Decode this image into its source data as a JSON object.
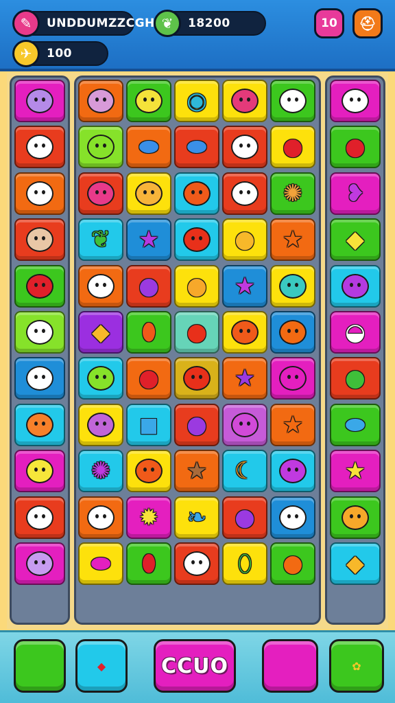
{
  "hud": {
    "player_name": "UNDDUMZZCGH",
    "score": "18200",
    "coins": "100",
    "level": "10",
    "icons": {
      "player": "pencil-icon",
      "score": "leaf-icon",
      "coins": "bird-coin-icon",
      "level": "level-badge",
      "shop": "chef-hat-icon"
    }
  },
  "colors": {
    "hud_bg": "#1d6fc4",
    "board_bg": "#f5d98a",
    "bottom_bg": "#4fbcd8",
    "red": "#e83c1e",
    "orange": "#f26a12",
    "yellow": "#fde10c",
    "green": "#3cc71e",
    "lime": "#86e22a",
    "cyan": "#22c9ea",
    "blue": "#1f8ed8",
    "purple": "#9b2fe0",
    "magenta": "#e41fbf",
    "teal": "#66d4b8",
    "mustard": "#d9b21a",
    "violet": "#c65bd8"
  },
  "grid": {
    "left_column": [
      {
        "bg": "magenta",
        "icon": "ghost-face-icon",
        "fg": "#b58ae8"
      },
      {
        "bg": "red",
        "icon": "bear-face-icon",
        "fg": "#ffffff"
      },
      {
        "bg": "orange",
        "icon": "bear-face-icon",
        "fg": "#ffffff"
      },
      {
        "bg": "red",
        "icon": "blob-face-icon",
        "fg": "#e9c7a6"
      },
      {
        "bg": "green",
        "icon": "strawberry-face-icon",
        "fg": "#e0202a"
      },
      {
        "bg": "lime",
        "icon": "ghost-face-icon",
        "fg": "#ffffff"
      },
      {
        "bg": "blue",
        "icon": "ghost-face-icon",
        "fg": "#ffffff"
      },
      {
        "bg": "cyan",
        "icon": "orange-face-icon",
        "fg": "#f7802a"
      },
      {
        "bg": "magenta",
        "icon": "lemon-face-icon",
        "fg": "#f6e63a"
      },
      {
        "bg": "red",
        "icon": "egg-face-icon",
        "fg": "#ffffff"
      },
      {
        "bg": "magenta",
        "icon": "ghost-face-icon",
        "fg": "#c79cf0"
      }
    ],
    "main_rows": [
      [
        {
          "bg": "orange",
          "icon": "ghost-face-icon",
          "fg": "#d89ad8"
        },
        {
          "bg": "green",
          "icon": "sun-face-icon",
          "fg": "#f4e23a"
        },
        {
          "bg": "yellow",
          "icon": "bird-icon",
          "fg": "#2fb8d8"
        },
        {
          "bg": "yellow",
          "icon": "urchin-face-icon",
          "fg": "#e43a7a"
        },
        {
          "bg": "green",
          "icon": "ghost-face-icon",
          "fg": "#ffffff"
        }
      ],
      [
        {
          "bg": "lime",
          "icon": "ghost-face-icon",
          "fg": "#86e22a"
        },
        {
          "bg": "orange",
          "icon": "candy-icon",
          "fg": "#3a8fe8"
        },
        {
          "bg": "red",
          "icon": "candy-icon",
          "fg": "#3a8fe8"
        },
        {
          "bg": "red",
          "icon": "egg-face-icon",
          "fg": "#ffffff"
        },
        {
          "bg": "yellow",
          "icon": "tomato-icon",
          "fg": "#e0202a"
        }
      ],
      [
        {
          "bg": "red",
          "icon": "berry-face-icon",
          "fg": "#e83a8a"
        },
        {
          "bg": "yellow",
          "icon": "cat-face-icon",
          "fg": "#f7b43a"
        },
        {
          "bg": "cyan",
          "icon": "orange-face-icon",
          "fg": "#f05a1a"
        },
        {
          "bg": "red",
          "icon": "bear-face-icon",
          "fg": "#ffffff"
        },
        {
          "bg": "green",
          "icon": "cookie-icon",
          "fg": "#f2a23a"
        }
      ],
      [
        {
          "bg": "cyan",
          "icon": "leaf-icon",
          "fg": "#3fbf3a"
        },
        {
          "bg": "blue",
          "icon": "star-icon",
          "fg": "#b43ae0"
        },
        {
          "bg": "cyan",
          "icon": "tomato-face-icon",
          "fg": "#e8301a"
        },
        {
          "bg": "yellow",
          "icon": "orange-fruit-icon",
          "fg": "#f7b82a"
        },
        {
          "bg": "orange",
          "icon": "star-icon",
          "fg": "#f26a12"
        }
      ],
      [
        {
          "bg": "orange",
          "icon": "ghost-face-icon",
          "fg": "#ffffff"
        },
        {
          "bg": "red",
          "icon": "plum-icon",
          "fg": "#9b3ae0"
        },
        {
          "bg": "yellow",
          "icon": "orange-fruit-icon",
          "fg": "#f7a82a"
        },
        {
          "bg": "blue",
          "icon": "star-icon",
          "fg": "#c03ae0"
        },
        {
          "bg": "yellow",
          "icon": "fish-face-icon",
          "fg": "#3ac9c0"
        }
      ],
      [
        {
          "bg": "purple",
          "icon": "gem-icon",
          "fg": "#f7b82a"
        },
        {
          "bg": "green",
          "icon": "carrot-icon",
          "fg": "#f05a1a"
        },
        {
          "bg": "teal",
          "icon": "tomato-icon",
          "fg": "#e8301a"
        },
        {
          "bg": "yellow",
          "icon": "cat-face-icon",
          "fg": "#f05a1a"
        },
        {
          "bg": "blue",
          "icon": "blob-face-icon",
          "fg": "#f26a12"
        }
      ],
      [
        {
          "bg": "cyan",
          "icon": "ghost-face-icon",
          "fg": "#86e22a"
        },
        {
          "bg": "orange",
          "icon": "apple-icon",
          "fg": "#e0202a"
        },
        {
          "bg": "mustard",
          "icon": "tomato-face-icon",
          "fg": "#e8301a"
        },
        {
          "bg": "orange",
          "icon": "star-icon",
          "fg": "#9b3ae0"
        },
        {
          "bg": "magenta",
          "icon": "ghost-face-icon",
          "fg": "#e41fbf"
        }
      ],
      [
        {
          "bg": "yellow",
          "icon": "ghost-face-icon",
          "fg": "#c065d8"
        },
        {
          "bg": "cyan",
          "icon": "box-icon",
          "fg": "#3aa8e8"
        },
        {
          "bg": "red",
          "icon": "plum-icon",
          "fg": "#9b3ae0"
        },
        {
          "bg": "violet",
          "icon": "ghost-face-icon",
          "fg": "#d14ad8"
        },
        {
          "bg": "orange",
          "icon": "star-icon",
          "fg": "#f26a12"
        }
      ],
      [
        {
          "bg": "cyan",
          "icon": "cookie-icon",
          "fg": "#c03ae0"
        },
        {
          "bg": "yellow",
          "icon": "cat-face-icon",
          "fg": "#f05a1a"
        },
        {
          "bg": "orange",
          "icon": "star-icon",
          "fg": "#a86a3a"
        },
        {
          "bg": "cyan",
          "icon": "banana-icon",
          "fg": "#f7a82a"
        },
        {
          "bg": "cyan",
          "icon": "urchin-face-icon",
          "fg": "#c03ae0"
        }
      ],
      [
        {
          "bg": "orange",
          "icon": "ghost-face-icon",
          "fg": "#ffffff"
        },
        {
          "bg": "magenta",
          "icon": "pineapple-icon",
          "fg": "#f7e23a"
        },
        {
          "bg": "yellow",
          "icon": "feather-icon",
          "fg": "#3aa8e8"
        },
        {
          "bg": "red",
          "icon": "plum-icon",
          "fg": "#9b3ae0"
        },
        {
          "bg": "blue",
          "icon": "ghost-face-icon",
          "fg": "#ffffff"
        }
      ],
      [
        {
          "bg": "yellow",
          "icon": "candy-icon",
          "fg": "#e41fbf"
        },
        {
          "bg": "green",
          "icon": "jar-icon",
          "fg": "#e0202a"
        },
        {
          "bg": "red",
          "icon": "bear-face-icon",
          "fg": "#ffffff"
        },
        {
          "bg": "yellow",
          "icon": "cucumber-icon",
          "fg": "#3fbf3a"
        },
        {
          "bg": "green",
          "icon": "orange-fruit-icon",
          "fg": "#f26a12"
        }
      ]
    ],
    "right_column": [
      {
        "bg": "magenta",
        "icon": "ghost-face-icon",
        "fg": "#ffffff"
      },
      {
        "bg": "green",
        "icon": "tomato-icon",
        "fg": "#e0202a"
      },
      {
        "bg": "magenta",
        "icon": "fish-icon",
        "fg": "#c03ae0"
      },
      {
        "bg": "green",
        "icon": "lemon-icon",
        "fg": "#f7e23a"
      },
      {
        "bg": "cyan",
        "icon": "ghost-face-icon",
        "fg": "#b43ae0"
      },
      {
        "bg": "magenta",
        "icon": "shell-icon",
        "fg": "#ffffff"
      },
      {
        "bg": "red",
        "icon": "apple-icon",
        "fg": "#3fbf3a"
      },
      {
        "bg": "green",
        "icon": "candy-icon",
        "fg": "#3aa8e8"
      },
      {
        "bg": "magenta",
        "icon": "star-icon",
        "fg": "#f7e23a"
      },
      {
        "bg": "green",
        "icon": "orange-face-icon",
        "fg": "#f7a82a"
      },
      {
        "bg": "cyan",
        "icon": "gem-icon",
        "fg": "#f7b82a"
      }
    ]
  },
  "bottom_bar": {
    "combo_label": "CCUO",
    "buttons": [
      {
        "bg": "green",
        "icon": "ghost-face-icon",
        "fg": "#ffffff"
      },
      {
        "bg": "cyan",
        "icon": "gem-icon",
        "fg": "#e0202a"
      },
      {
        "bg": "magenta",
        "icon": "ghost-face-icon",
        "fg": "#d47ad8"
      },
      {
        "bg": "green",
        "icon": "sunflower-icon",
        "fg": "#f7c82a"
      }
    ]
  }
}
